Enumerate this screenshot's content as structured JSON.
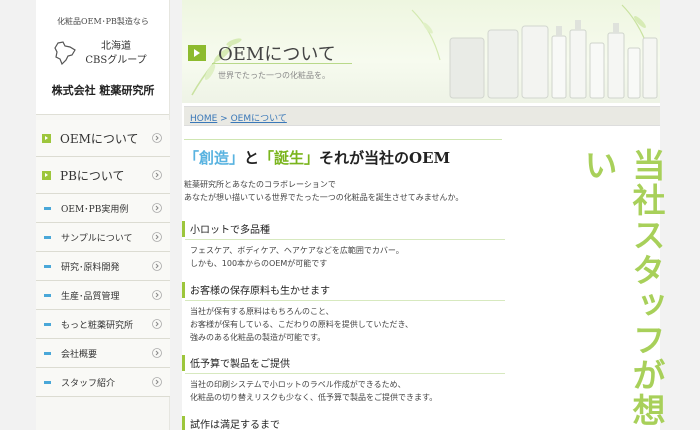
{
  "sidebar": {
    "tagline": "化粧品OEM･PB製造なら",
    "group_line1": "北海道",
    "group_line2": "CBSグループ",
    "company": "株式会社 粧薬研究所",
    "items": [
      {
        "label": "OEMについて",
        "style": "big"
      },
      {
        "label": "PBについて",
        "style": "big"
      },
      {
        "label": "OEM･PB実用例",
        "style": "small"
      },
      {
        "label": "サンプルについて",
        "style": "small"
      },
      {
        "label": "研究･原料開発",
        "style": "small"
      },
      {
        "label": "生産･品質管理",
        "style": "small"
      },
      {
        "label": "もっと粧薬研究所",
        "style": "small"
      },
      {
        "label": "会社概要",
        "style": "small"
      },
      {
        "label": "スタッフ紹介",
        "style": "small"
      }
    ]
  },
  "banner": {
    "title": "OEMについて",
    "subtitle": "世界でたった一つの化粧品を。"
  },
  "breadcrumb": {
    "home": "HOME",
    "sep": " > ",
    "current": "OEMについて"
  },
  "headline": {
    "q1": "「創造」",
    "to": "と",
    "q2": "「誕生」",
    "rest": "それが当社のOEM"
  },
  "intro": {
    "line1": "粧薬研究所とあなたのコラボレーションで",
    "line2": "あなたが想い描いている世界でたった一つの化粧品を誕生させてみませんか。"
  },
  "sections": [
    {
      "title": "小ロットで多品種",
      "lines": [
        "フェスケア、ボディケア、ヘアケアなどを広範囲でカバー。",
        "しかも、100本からのOEMが可能です"
      ]
    },
    {
      "title": "お客様の保存原料も生かせます",
      "lines": [
        "当社が保有する原料はもちろんのこと、",
        "お客様が保有している、こだわりの原料を提供していただき、",
        "強みのある化粧品の製造が可能です。"
      ]
    },
    {
      "title": "低予算で製品をご提供",
      "lines": [
        "当社の印刷システムで小ロットのラベル作成ができるため、",
        "化粧品の切り替えリスクも少なく、低予算で製品をご提供できます。"
      ]
    },
    {
      "title": "試作は満足するまで",
      "lines": []
    }
  ],
  "vertical_text": "当社スタッフが想い",
  "colors": {
    "accent_green": "#9dc63c",
    "accent_blue": "#49a7d8",
    "vertical_text": "#a8d05a"
  }
}
